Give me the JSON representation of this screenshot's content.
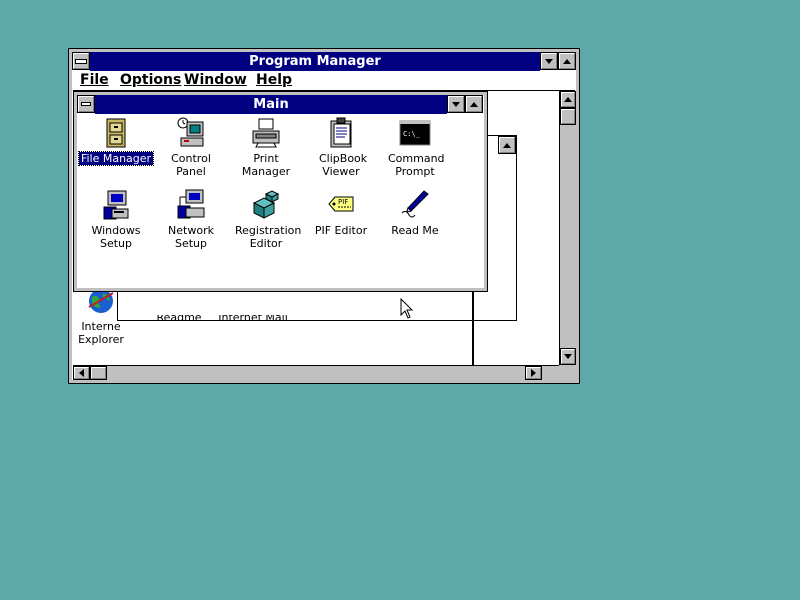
{
  "colors": {
    "desktop": "#5ea8a8",
    "title_active": "#000080",
    "face": "#c0c0c0"
  },
  "program_manager": {
    "title": "Program Manager",
    "menu": [
      {
        "label": "File"
      },
      {
        "label": "Options"
      },
      {
        "label": "Window"
      },
      {
        "label": "Help"
      }
    ],
    "background_icons": [
      {
        "label_line1": "Interne",
        "label_line2": "Explorer",
        "icon": "internet-explorer-icon"
      },
      {
        "label_line1": "Readme",
        "icon": "readme-icon"
      },
      {
        "label_line1": "Internet Mail",
        "icon": "internet-mail-icon"
      }
    ]
  },
  "main_group": {
    "title": "Main",
    "items": [
      {
        "label": "File Manager",
        "icon": "file-manager-icon",
        "selected": true
      },
      {
        "label": "Control Panel",
        "icon": "control-panel-icon"
      },
      {
        "label": "Print Manager",
        "icon": "printer-icon"
      },
      {
        "label": "ClipBook Viewer",
        "icon": "clipbook-icon"
      },
      {
        "label": "Command Prompt",
        "icon": "command-prompt-icon"
      },
      {
        "label": "Windows Setup",
        "icon": "windows-setup-icon"
      },
      {
        "label": "Network Setup",
        "icon": "network-setup-icon"
      },
      {
        "label": "Registration Editor",
        "icon": "registry-icon"
      },
      {
        "label": "PIF Editor",
        "icon": "pif-icon",
        "icon_text": "PIF"
      },
      {
        "label": "Read Me",
        "icon": "read-me-icon"
      }
    ],
    "command_prompt_text": "C:\\_"
  }
}
